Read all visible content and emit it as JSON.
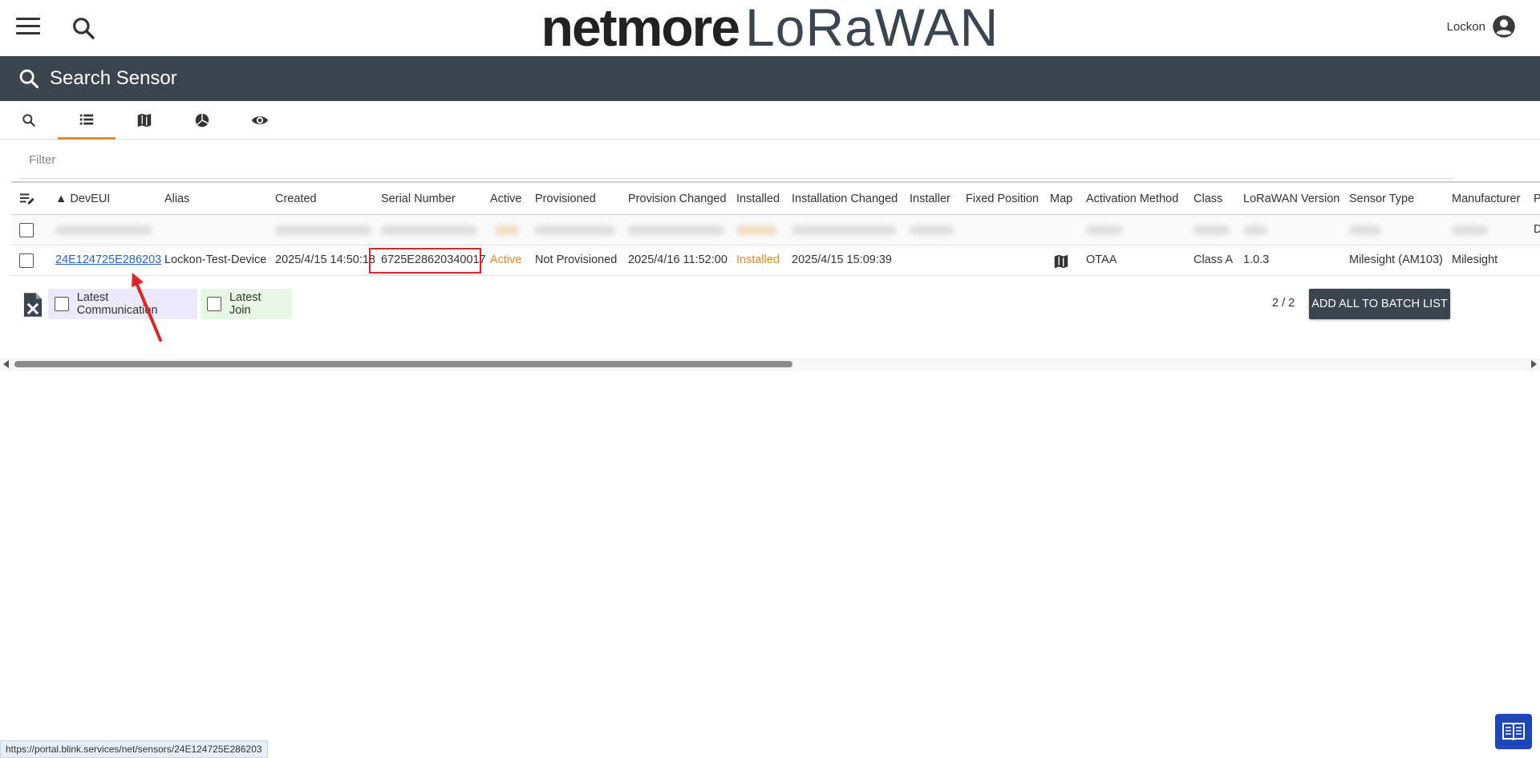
{
  "header": {
    "brand_bold": "netmore",
    "brand_light": "LoRaWAN",
    "user_name": "Lockon"
  },
  "search_bar": {
    "title": "Search Sensor"
  },
  "tabs": [
    {
      "icon": "search-icon",
      "active": false
    },
    {
      "icon": "list-icon",
      "active": true
    },
    {
      "icon": "map-icon",
      "active": false
    },
    {
      "icon": "pie-chart-icon",
      "active": false
    },
    {
      "icon": "eye-icon",
      "active": false
    }
  ],
  "filter": {
    "placeholder": "Filter"
  },
  "table": {
    "columns": [
      "▲ DevEUI",
      "Alias",
      "Created",
      "Serial Number",
      "Active",
      "Provisioned",
      "Provision Changed",
      "Installed",
      "Installation Changed",
      "Installer",
      "Fixed Position",
      "Map",
      "Activation Method",
      "Class",
      "LoRaWAN Version",
      "Sensor Type",
      "Manufacturer",
      "P"
    ],
    "blurred_row_trailing": "D",
    "row": {
      "deveui": "24E124725E286203",
      "alias": "Lockon-Test-Device",
      "created": "2025/4/15 14:50:18",
      "serial_number": "6725E28620340017",
      "active": "Active",
      "provisioned": "Not Provisioned",
      "provision_changed": "2025/4/16 11:52:00",
      "installed": "Installed",
      "installation_changed": "2025/4/15 15:09:39",
      "installer": "",
      "fixed_position": "",
      "activation_method": "OTAA",
      "class": "Class A",
      "lorawan_version": "1.0.3",
      "sensor_type": "Milesight (AM103)",
      "manufacturer": "Milesight"
    }
  },
  "footer": {
    "latest_communication": "Latest Communication",
    "latest_join": "Latest Join",
    "count": "2 / 2",
    "batch_button": "ADD ALL TO BATCH LIST"
  },
  "status_url": "https://portal.blink.services/net/sensors/24E124725E286203",
  "colors": {
    "dark": "#3a4550",
    "accent": "#e8862a",
    "link": "#2a62c9",
    "highlight": "#e02424",
    "book_button": "#1d47b7"
  }
}
